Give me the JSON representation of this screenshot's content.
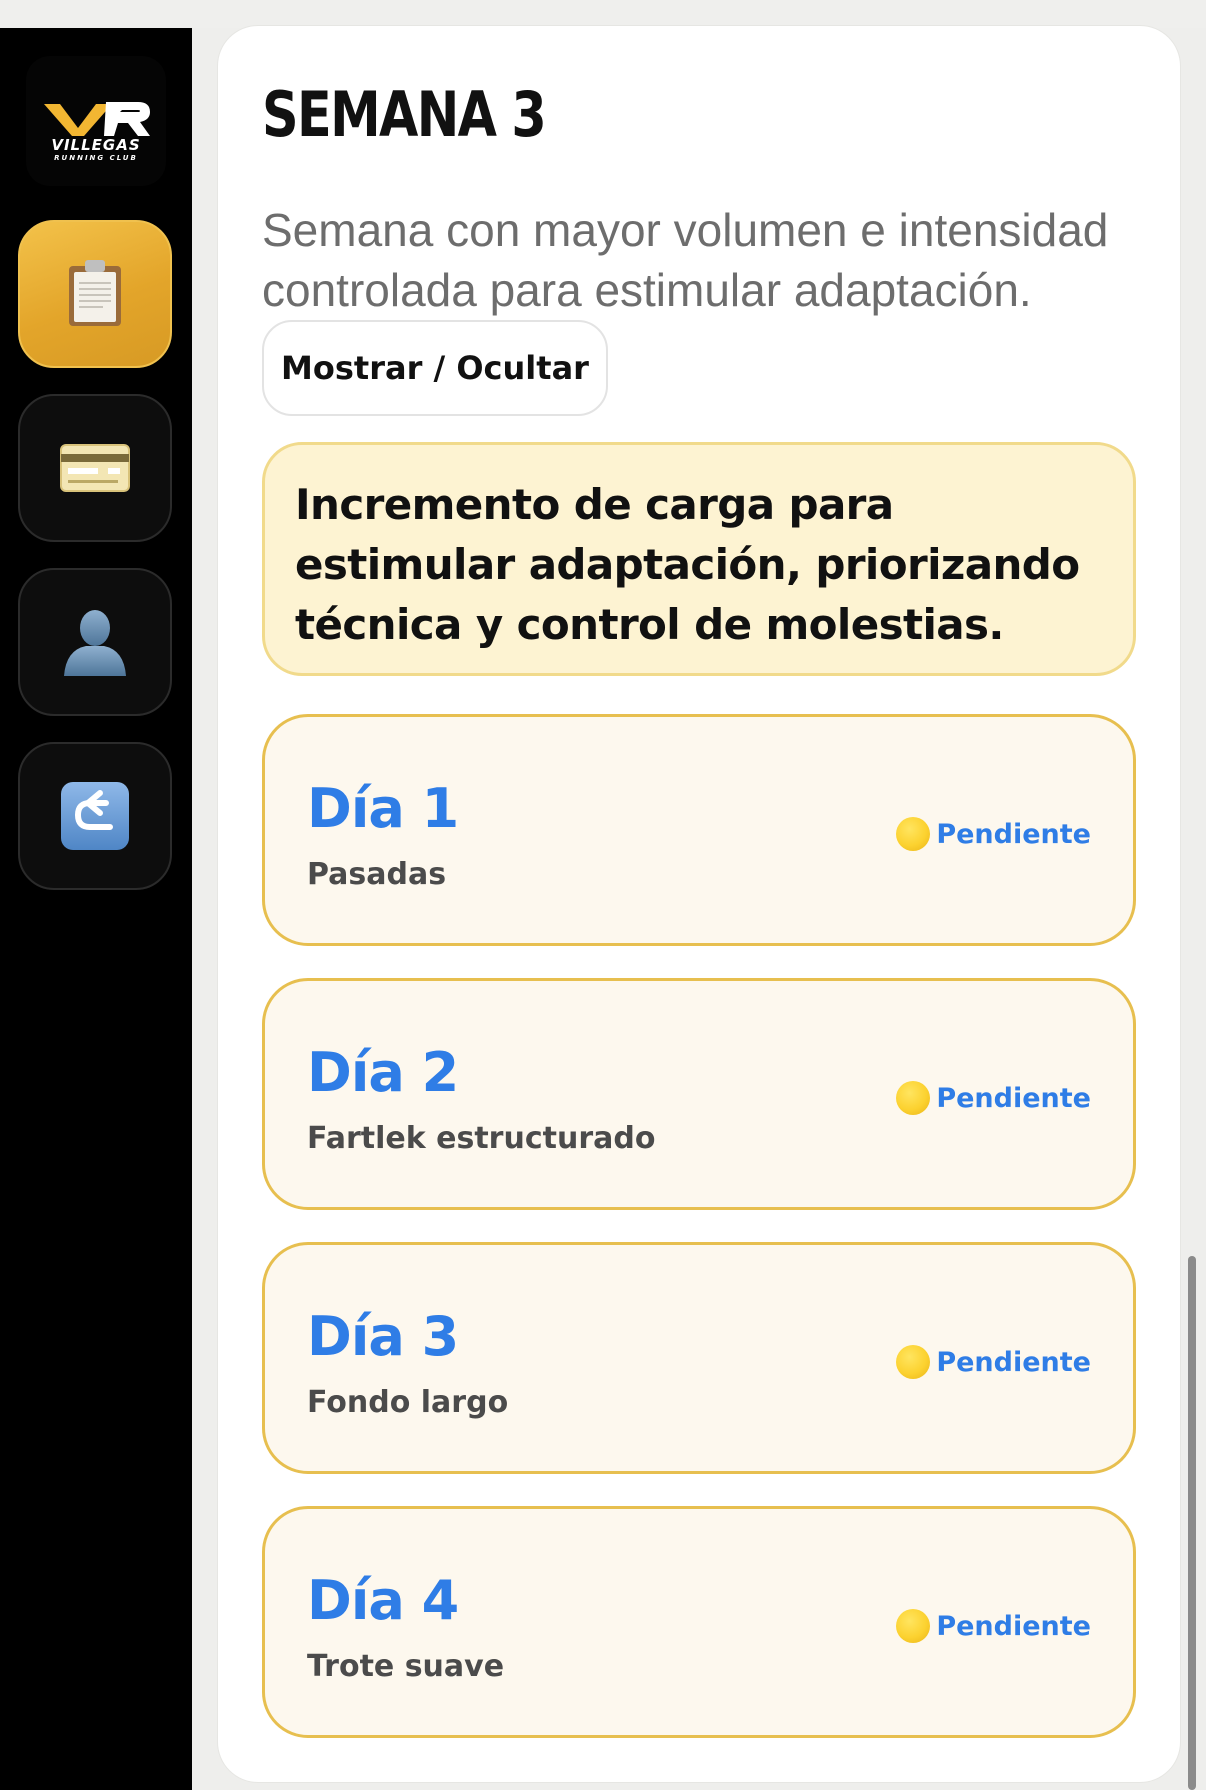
{
  "sidebar": {
    "logo": {
      "brand": "VILLEGAS",
      "subtitle": "RUNNING CLUB",
      "monogram": "VR",
      "colors": {
        "gold": "#f2b632",
        "white": "#ffffff"
      }
    },
    "items": [
      {
        "name": "plan",
        "icon": "clipboard-icon",
        "active": true
      },
      {
        "name": "payments",
        "icon": "credit-card-icon",
        "active": false
      },
      {
        "name": "profile",
        "icon": "user-silhouette-icon",
        "active": false
      },
      {
        "name": "back",
        "icon": "return-arrow-icon",
        "active": false
      }
    ]
  },
  "week": {
    "title": "SEMANA 3",
    "description": "Semana con mayor volumen e intensidad controlada para estimular adaptación.",
    "toggle_label": "Mostrar / Ocultar",
    "note": "Incremento de carga para estimular adaptación, priorizando técnica y control de molestias."
  },
  "days": [
    {
      "title": "Día 1",
      "subtitle": "Pasadas",
      "status": "Pendiente",
      "status_icon": "yellow-circle-icon"
    },
    {
      "title": "Día 2",
      "subtitle": "Fartlek estructurado",
      "status": "Pendiente",
      "status_icon": "yellow-circle-icon"
    },
    {
      "title": "Día 3",
      "subtitle": "Fondo largo",
      "status": "Pendiente",
      "status_icon": "yellow-circle-icon"
    },
    {
      "title": "Día 4",
      "subtitle": "Trote suave",
      "status": "Pendiente",
      "status_icon": "yellow-circle-icon"
    }
  ],
  "colors": {
    "accent_blue": "#2f7de6",
    "gold": "#e7bf4f",
    "note_bg": "#fdf3d2",
    "day_bg": "#fdf8ee"
  }
}
